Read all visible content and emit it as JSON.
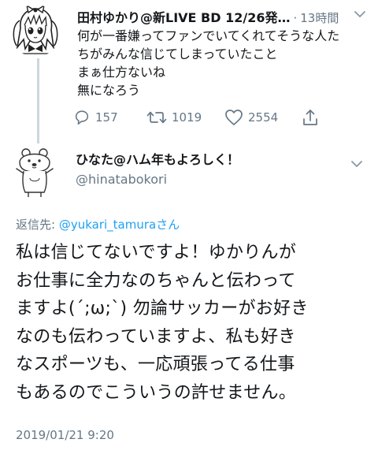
{
  "parent_tweet": {
    "author_name": "田村ゆかり@新LIVE BD 12/26発…",
    "separator": "·",
    "time": "13時間",
    "text": "何が一番嫌ってファンでいてくれてそうな人た\nちがみんな信じてしまっていたこと\nまぁ仕方ないね\n無になろう",
    "reply_count": "157",
    "retweet_count": "1019",
    "like_count": "2554"
  },
  "reply_tweet": {
    "author_name": "ひなた@ハム年もよろしく！",
    "handle": "@hinatabokori",
    "reply_to_prefix": "返信先: ",
    "reply_to_user": "@yukari_tamura",
    "reply_to_suffix": "さん",
    "text": "私は信じてないですよ！ゆかりんが\nお仕事に全力なのちゃんと伝わって\nますよ(´;ω;`) 勿論サッカーがお好き\nなのも伝わっていますよ、私も好き\nなスポーツも、一応頑張ってる仕事\nもあるのでこういうの許せません。",
    "date": "2019/01/21 9:20"
  },
  "icons": {
    "reply": "reply-icon",
    "retweet": "retweet-icon",
    "like": "like-icon",
    "share": "share-icon",
    "more": "chevron-down-icon",
    "avatar_parent": "anime-girl-avatar",
    "avatar_reply": "bear-character-avatar"
  },
  "colors": {
    "text": "#14171a",
    "secondary": "#657786",
    "link": "#1da1f2",
    "thread_line": "#ccd6dd"
  }
}
